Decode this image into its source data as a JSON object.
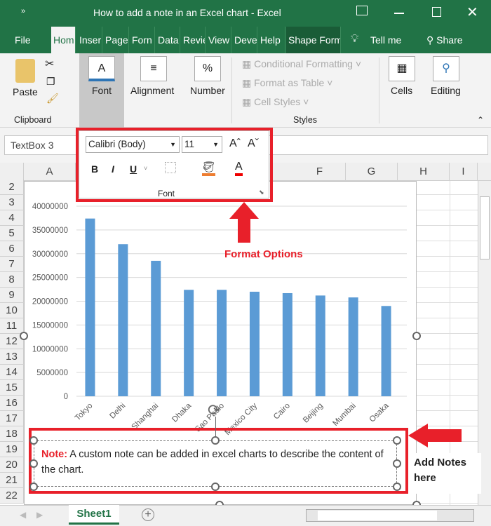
{
  "window": {
    "title": "How to add a note in an Excel chart  -  Excel"
  },
  "tabs": [
    "File",
    "Hom",
    "Inser",
    "Page",
    "Forn",
    "Data",
    "Revie",
    "View",
    "Deve",
    "Help",
    "Shape Form"
  ],
  "tell_me": "Tell me",
  "share": "Share",
  "ribbon": {
    "paste": "Paste",
    "clipboard": "Clipboard",
    "font": "Font",
    "alignment": "Alignment",
    "number": "Number",
    "conditional": "Conditional Formatting",
    "format_table": "Format as Table",
    "cell_styles": "Cell Styles",
    "styles": "Styles",
    "cells": "Cells",
    "editing": "Editing"
  },
  "name_box": "TextBox 3",
  "columns": [
    "A",
    "F",
    "G",
    "H",
    "I"
  ],
  "rows": [
    "2",
    "3",
    "4",
    "5",
    "6",
    "7",
    "8",
    "9",
    "10",
    "11",
    "12",
    "13",
    "14",
    "15",
    "16",
    "17",
    "18",
    "19",
    "20",
    "21",
    "22"
  ],
  "font_popup": {
    "font_name": "Calibri (Body)",
    "font_size": "11",
    "bold": "B",
    "italic": "I",
    "underline": "U",
    "label": "Font"
  },
  "annotations": {
    "format_options": "Format Options",
    "add_notes": "Add Notes here"
  },
  "note": {
    "prefix": "Note:",
    "text": " A custom note can be added in excel charts to describe the content of the chart."
  },
  "sheet_tab": "Sheet1",
  "colors": {
    "excel_green": "#217346",
    "bar": "#5b9bd5",
    "highlight": "#e8202a"
  },
  "chart_data": {
    "type": "bar",
    "categories": [
      "Tokyo",
      "Delhi",
      "Shanghai",
      "Dhaka",
      "Sao Paulo",
      "Mexico City",
      "Cairo",
      "Beijing",
      "Mumbai",
      "Osaka"
    ],
    "values": [
      37400000,
      32000000,
      28500000,
      22400000,
      22400000,
      22000000,
      21700000,
      21200000,
      20800000,
      19000000
    ],
    "yticks": [
      "0",
      "5000000",
      "10000000",
      "15000000",
      "20000000",
      "25000000",
      "30000000",
      "35000000",
      "40000000"
    ],
    "ylim": [
      0,
      40000000
    ],
    "title": "",
    "xlabel": "",
    "ylabel": ""
  }
}
